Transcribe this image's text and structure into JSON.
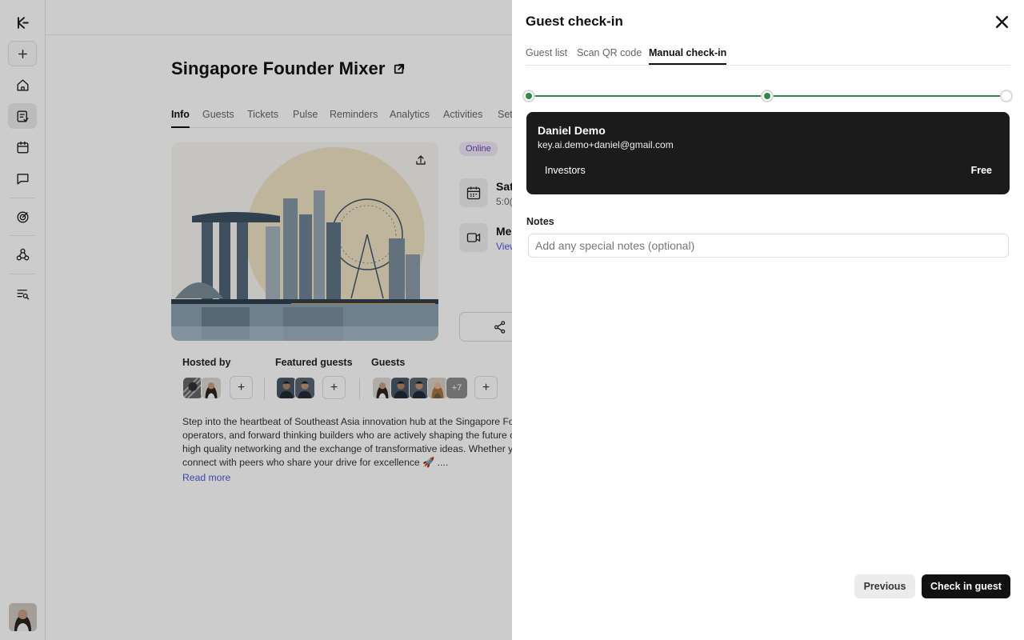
{
  "sidebar": {
    "items": [
      {
        "icon": "logo-icon"
      },
      {
        "icon": "plus-icon"
      },
      {
        "icon": "home-icon"
      },
      {
        "icon": "events-icon"
      },
      {
        "icon": "calendar-icon"
      },
      {
        "icon": "chat-icon"
      },
      {
        "icon": "target-icon"
      },
      {
        "icon": "network-icon"
      },
      {
        "icon": "search-list-icon"
      }
    ]
  },
  "event": {
    "title": "Singapore Founder Mixer",
    "tabs": [
      "Info",
      "Guests",
      "Tickets",
      "Pulse",
      "Reminders",
      "Analytics",
      "Activities",
      "Set"
    ],
    "online_badge": "Online",
    "date_line1": "Sat",
    "date_line2": "5:0(",
    "location_line1": "Me",
    "location_line2": "View",
    "hosted_by_label": "Hosted by",
    "featured_guests_label": "Featured guests",
    "guests_label": "Guests",
    "guests_more": "+7",
    "description_lines": [
      "Step into the heartbeat of Southeast Asia innovation hub at the Singapore Fo",
      "operators, and forward thinking builders who are actively shaping the future c",
      "high quality networking and the exchange of transformative ideas. Whether y",
      "connect with peers who share your drive for excellence 🚀 ...."
    ],
    "read_more": "Read more"
  },
  "drawer": {
    "title": "Guest check-in",
    "tabs": [
      "Guest list",
      "Scan QR code",
      "Manual check-in"
    ],
    "active_tab": "Manual check-in",
    "stepper": {
      "total_steps": 3,
      "completed_steps": 2,
      "accent": "#2f8a4a"
    },
    "guest": {
      "name": "Daniel Demo",
      "email": "key.ai.demo+daniel@gmail.com",
      "ticket": "Investors",
      "price": "Free"
    },
    "notes_label": "Notes",
    "notes_placeholder": "Add any special notes (optional)",
    "notes_value": "",
    "prev_label": "Previous",
    "check_in_label": "Check in guest"
  },
  "colors": {
    "overlay": "rgba(0,0,0,0.2)",
    "card_bg": "#1b1b1b",
    "primary_button": "#111111",
    "link": "#4a5bd6",
    "online_badge_text": "#6b3fb8"
  }
}
